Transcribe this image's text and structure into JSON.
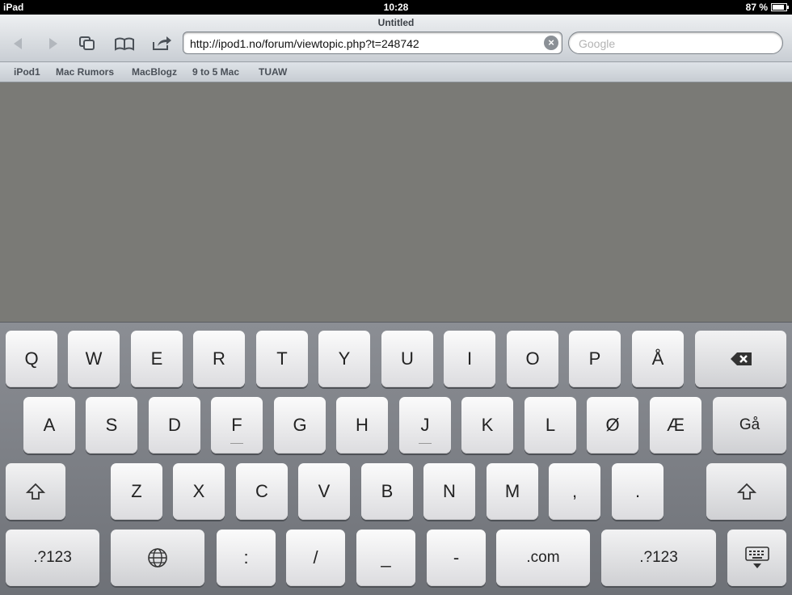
{
  "status": {
    "device": "iPad",
    "time": "10:28",
    "battery": "87 %",
    "battery_level": 0.87
  },
  "browser": {
    "title": "Untitled",
    "url": "http://ipod1.no/forum/viewtopic.php?t=248742",
    "search_placeholder": "Google",
    "bookmarks": [
      "iPod1",
      "Mac Rumors",
      "MacBlogz",
      "9 to 5 Mac",
      "TUAW"
    ]
  },
  "keyboard": {
    "row1": [
      "Q",
      "W",
      "E",
      "R",
      "T",
      "Y",
      "U",
      "I",
      "O",
      "P",
      "Å"
    ],
    "row2": [
      "A",
      "S",
      "D",
      "F",
      "G",
      "H",
      "J",
      "K",
      "L",
      "Ø",
      "Æ"
    ],
    "go": "Gå",
    "row3": [
      "Z",
      "X",
      "C",
      "V",
      "B",
      "N",
      "M",
      ",",
      "."
    ],
    "bottom": {
      "num_left": ".?123",
      "colon": ":",
      "slash": "/",
      "underscore": "_",
      "dash": "-",
      "dotcom": ".com",
      "num_right": ".?123"
    },
    "icons": {
      "backspace": "backspace-icon",
      "shift": "shift-icon",
      "globe": "globe-icon",
      "hide": "keyboard-hide-icon"
    }
  }
}
